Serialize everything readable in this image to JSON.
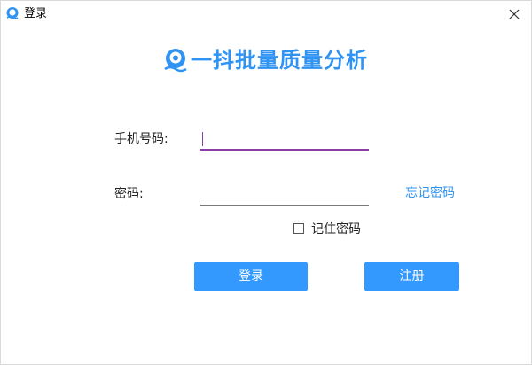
{
  "window": {
    "title": "登录",
    "close_icon": "close-icon"
  },
  "logo": {
    "icon": "duck-logo-icon",
    "text": "一抖批量质量分析"
  },
  "form": {
    "phone_label": "手机号码:",
    "phone_value": "",
    "password_label": "密码:",
    "password_value": "",
    "forgot_link": "忘记密码",
    "remember_label": "记住密码",
    "remember_checked": false
  },
  "buttons": {
    "login": "登录",
    "register": "注册"
  },
  "colors": {
    "accent": "#2f93f3",
    "button_bg": "#3399ff",
    "focus_underline": "#8a3ea6"
  }
}
